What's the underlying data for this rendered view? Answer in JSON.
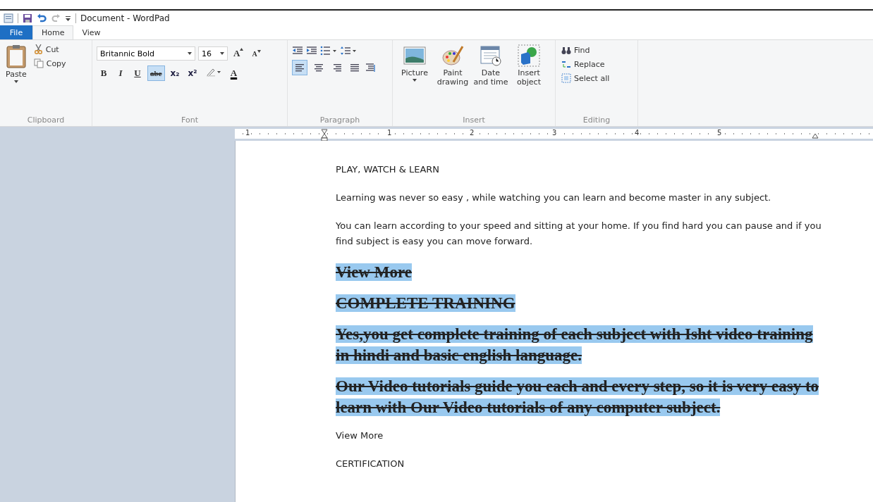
{
  "window": {
    "title": "Document - WordPad"
  },
  "tabs": [
    {
      "label": "File",
      "kind": "file",
      "selected": false
    },
    {
      "label": "Home",
      "kind": "tab",
      "selected": true
    },
    {
      "label": "View",
      "kind": "tab",
      "selected": false
    }
  ],
  "clipboard": {
    "paste": "Paste",
    "cut": "Cut",
    "copy": "Copy",
    "label": "Clipboard"
  },
  "font": {
    "family": "Britannic Bold",
    "size": "16",
    "grow": "A",
    "shrink": "A",
    "color_button": "A",
    "label": "Font",
    "format_buttons": [
      {
        "label": "B",
        "kind": "bold",
        "selected": false
      },
      {
        "label": "I",
        "kind": "italic",
        "selected": false
      },
      {
        "label": "U",
        "kind": "underline",
        "selected": false
      },
      {
        "label": "abc",
        "kind": "strike",
        "selected": true
      },
      {
        "label": "x₂",
        "kind": "sub",
        "selected": false
      },
      {
        "label": "x²",
        "kind": "sup",
        "selected": false
      }
    ]
  },
  "paragraph": {
    "label": "Paragraph",
    "align": [
      {
        "kind": "left",
        "selected": true
      },
      {
        "kind": "center",
        "selected": false
      },
      {
        "kind": "right",
        "selected": false
      },
      {
        "kind": "justify",
        "selected": false
      }
    ]
  },
  "insert": {
    "label": "Insert",
    "buttons": [
      {
        "label": "Picture",
        "kind": "picture",
        "dropdown": true
      },
      {
        "label": "Paint drawing",
        "kind": "paint",
        "dropdown": false
      },
      {
        "label": "Date and time",
        "kind": "calendar",
        "dropdown": false
      },
      {
        "label": "Insert object",
        "kind": "object",
        "dropdown": false
      }
    ]
  },
  "editing": {
    "label": "Editing",
    "items": [
      {
        "label": "Find",
        "kind": "find"
      },
      {
        "label": "Replace",
        "kind": "replace"
      },
      {
        "label": "Select all",
        "kind": "select"
      }
    ]
  },
  "ruler": {
    "numbers": [
      "1",
      "1",
      "2",
      "3",
      "4",
      "5"
    ]
  },
  "document": {
    "paragraphs": [
      {
        "text": "PLAY, WATCH & LEARN",
        "selected": false,
        "strikethrough": false
      },
      {
        "text": "Learning was never so easy , while watching you can learn and become master in any subject.",
        "selected": false,
        "strikethrough": false
      },
      {
        "text": "You can learn according to your speed and sitting at your home. If you find hard you can pause and if you find subject is easy you can move forward.",
        "selected": false,
        "strikethrough": false
      },
      {
        "text": "View More",
        "selected": true,
        "strikethrough": true
      },
      {
        "text": "COMPLETE TRAINING",
        "selected": true,
        "strikethrough": true
      },
      {
        "text": "Yes,you get complete training of each subject with Isht video training in hindi and basic english language.",
        "selected": true,
        "strikethrough": true
      },
      {
        "text": "Our Video tutorials guide you each and every step, so it is very easy to learn with Our Video tutorials of any computer subject.",
        "selected": true,
        "strikethrough": true
      },
      {
        "text": "View More",
        "selected": false,
        "strikethrough": false
      },
      {
        "text": "CERTIFICATION",
        "selected": false,
        "strikethrough": false
      }
    ]
  }
}
